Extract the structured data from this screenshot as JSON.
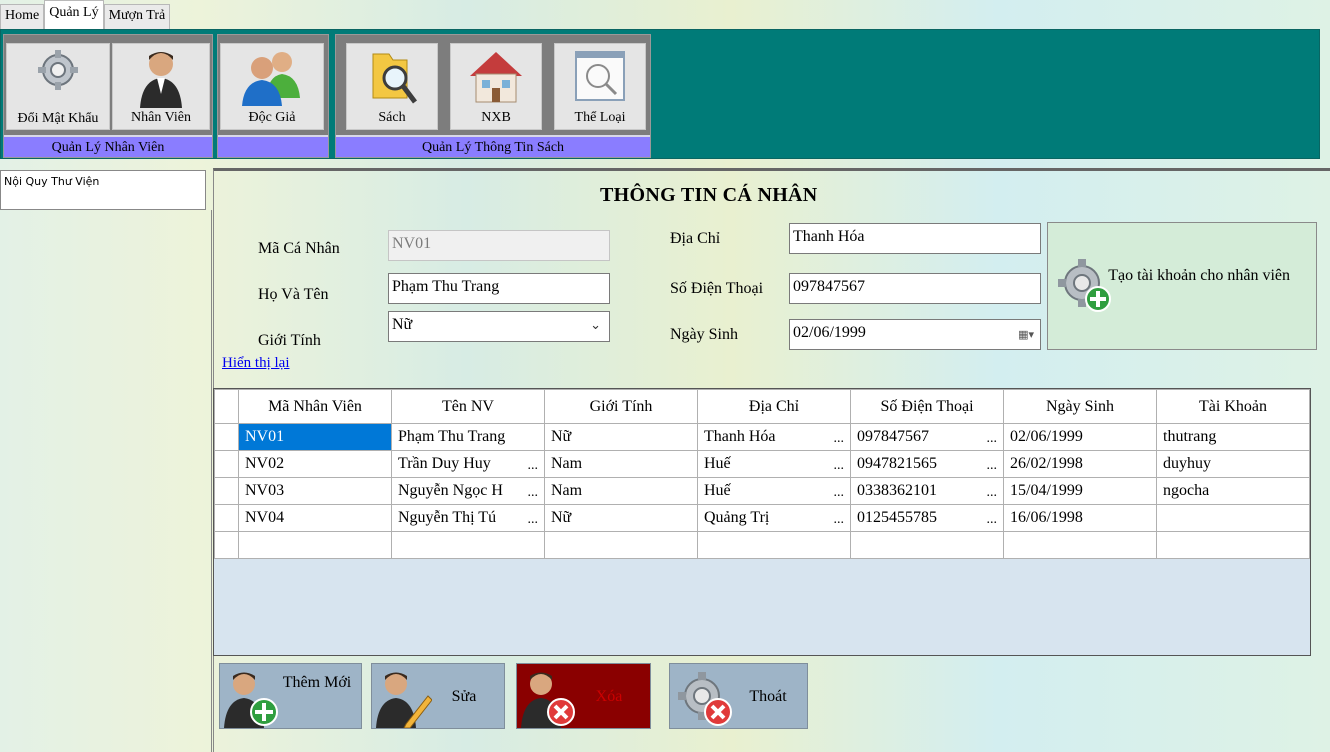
{
  "menu": {
    "tabs": [
      "Home",
      "Quản Lý",
      "Mượn Trả"
    ],
    "active_tab": "Quản Lý"
  },
  "ribbon": {
    "groups": [
      {
        "label": "Quản Lý Nhân Viên",
        "buttons": [
          {
            "label": "Đổi Mật Khẩu",
            "icon": "gear-icon"
          },
          {
            "label": "Nhân Viên",
            "icon": "person-icon"
          }
        ]
      },
      {
        "label": "",
        "buttons": [
          {
            "label": "Độc Giả",
            "icon": "people-icon"
          }
        ]
      },
      {
        "label": "Quản Lý Thông Tin Sách",
        "buttons": [
          {
            "label": "Sách",
            "icon": "folder-search-icon"
          },
          {
            "label": "NXB",
            "icon": "house-icon"
          },
          {
            "label": "Thể Loại",
            "icon": "magnifier-window-icon"
          }
        ]
      }
    ]
  },
  "sidebar": {
    "items": [
      "Nội Quy Thư Viện"
    ]
  },
  "form": {
    "title": "THÔNG TIN CÁ NHÂN",
    "ma_ca_nhan": {
      "label": "Mã Cá Nhân",
      "value": "NV01"
    },
    "ho_va_ten": {
      "label": "Họ Và Tên",
      "value": "Phạm Thu Trang"
    },
    "gioi_tinh": {
      "label": "Giới Tính",
      "value": "Nữ"
    },
    "dia_chi": {
      "label": "Địa Chỉ",
      "value": "Thanh Hóa"
    },
    "so_dien_thoai": {
      "label": "Số Điện Thoại",
      "value": "097847567"
    },
    "ngay_sinh": {
      "label": "Ngày Sinh",
      "value": "02/06/1999"
    },
    "reload_link": "Hiển thị lại",
    "create_account": {
      "label": "Tạo tài khoản cho nhân viên",
      "icon": "gear-add-icon"
    }
  },
  "grid": {
    "columns": [
      "Mã Nhân Viên",
      "Tên NV",
      "Giới Tính",
      "Địa Chỉ",
      "Số Điện Thoại",
      "Ngày Sinh",
      "Tài Khoản"
    ],
    "rows": [
      [
        "NV01",
        "Phạm Thu Trang",
        "Nữ",
        "Thanh Hóa",
        "097847567",
        "02/06/1999",
        "thutrang"
      ],
      [
        "NV02",
        "Trần Duy Huy",
        "Nam",
        "Huế",
        "0947821565",
        "26/02/1998",
        "duyhuy"
      ],
      [
        "NV03",
        "Nguyễn Ngọc H",
        "Nam",
        "Huế",
        "0338362101",
        "15/04/1999",
        "ngocha"
      ],
      [
        "NV04",
        "Nguyễn Thị Tú",
        "Nữ",
        "Quảng Trị",
        "0125455785",
        "16/06/1998",
        ""
      ]
    ],
    "selected_cell": "NV01"
  },
  "actions": {
    "add": {
      "label": "Thêm Mới",
      "icon": "person-add-icon"
    },
    "edit": {
      "label": "Sửa",
      "icon": "person-edit-icon"
    },
    "delete": {
      "label": "Xóa",
      "icon": "person-delete-icon"
    },
    "exit": {
      "label": "Thoát",
      "icon": "gear-close-icon"
    }
  },
  "colors": {
    "ribbon_bg": "#007b78",
    "group_label_bg": "#8a7dff",
    "button_bg": "#9eb4c7",
    "delete_bg": "#8a0000",
    "selection": "#0078d7"
  }
}
